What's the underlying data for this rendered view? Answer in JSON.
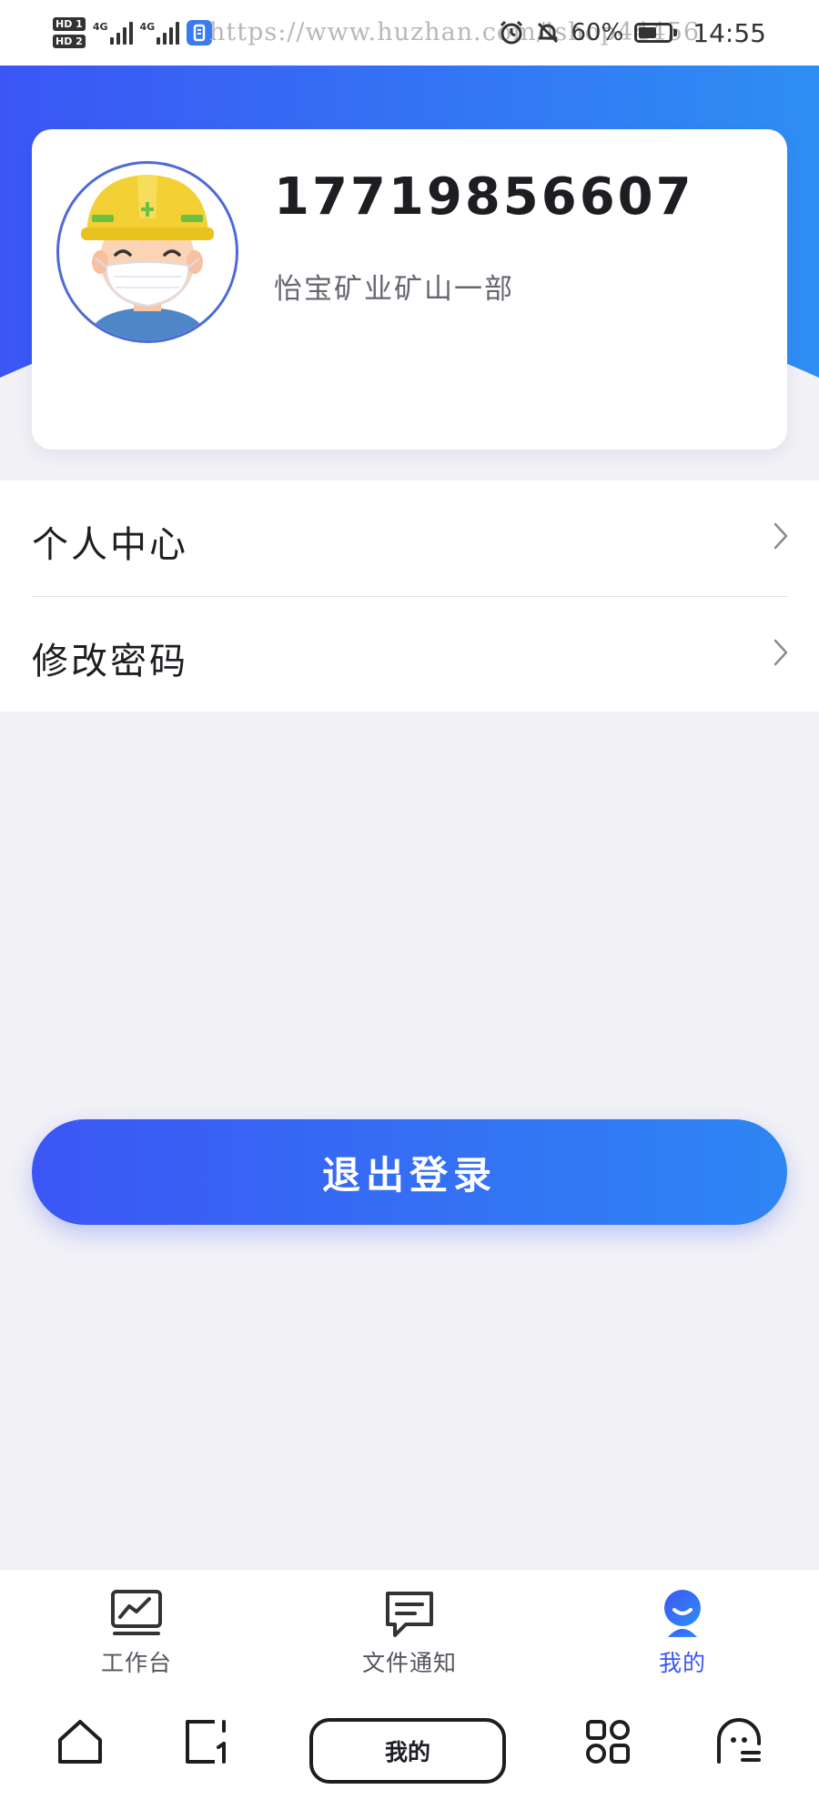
{
  "status_bar": {
    "sim1_label": "HD 1",
    "sim2_label": "HD 2",
    "network1": "4G",
    "network2": "4G",
    "watermark": "https://www.huzhan.com/ishop44456",
    "battery_percent": "60%",
    "battery_level": 0.6,
    "time": "14:55",
    "icons": [
      "hd-sim-icon",
      "signal-icon",
      "app-notification-icon",
      "alarm-icon",
      "mute-bell-icon",
      "battery-charging-icon"
    ]
  },
  "profile": {
    "phone": "17719856607",
    "organization": "怡宝矿业矿山一部",
    "avatar_icon": "worker-helmet-mask-avatar"
  },
  "menu": {
    "items": [
      {
        "label": "个人中心",
        "icon": "chevron-right-icon"
      },
      {
        "label": "修改密码",
        "icon": "chevron-right-icon"
      }
    ]
  },
  "logout": {
    "label": "退出登录"
  },
  "tabs": [
    {
      "label": "工作台",
      "icon": "monitor-chart-icon",
      "active": false
    },
    {
      "label": "文件通知",
      "icon": "message-icon",
      "active": false
    },
    {
      "label": "我的",
      "icon": "user-icon",
      "active": true
    }
  ],
  "system_nav": {
    "home_pill_label": "我的",
    "buttons": [
      "home-icon",
      "recent-apps-icon",
      "grid-apps-icon",
      "assistant-icon"
    ]
  },
  "colors": {
    "primary": "#3b56f5",
    "primary_end": "#2e86f3",
    "page_bg": "#f1f1f6",
    "text_primary": "#1d1d22",
    "text_secondary": "#666670"
  }
}
